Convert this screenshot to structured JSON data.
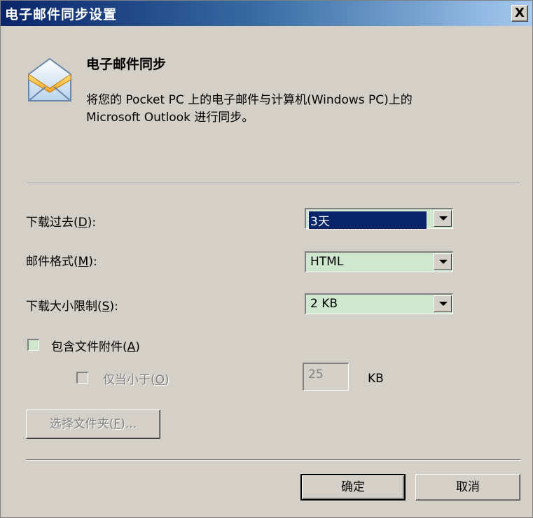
{
  "window": {
    "title": "电子邮件同步设置",
    "close_label": "X"
  },
  "header": {
    "icon": "envelope-icon",
    "title": "电子邮件同步",
    "description_line1": "将您的 Pocket PC 上的电子邮件与计算机(Windows PC)上的",
    "description_line2": "Microsoft Outlook 进行同步。"
  },
  "fields": {
    "download_past": {
      "label": "下载过去",
      "accel": "D",
      "value": "3天"
    },
    "mail_format": {
      "label": "邮件格式",
      "accel": "M",
      "value": "HTML"
    },
    "download_size_limit": {
      "label": "下载大小限制",
      "accel": "S",
      "value": "2 KB"
    }
  },
  "attachments": {
    "include_label": "包含文件附件",
    "include_accel": "A",
    "include_checked": false,
    "only_smaller_label": "仅当小于",
    "only_smaller_accel": "O",
    "only_smaller_checked": false,
    "size_value": "25",
    "size_unit": "KB"
  },
  "buttons": {
    "select_folders": "选择文件夹",
    "select_folders_accel": "F",
    "ok": "确定",
    "cancel": "取消"
  },
  "colors": {
    "titlebar_start": "#0a246a",
    "titlebar_end": "#a6caf0",
    "dialog_bg": "#d4d0c8",
    "field_bg": "#cfe6cf",
    "selection": "#0a246a"
  }
}
